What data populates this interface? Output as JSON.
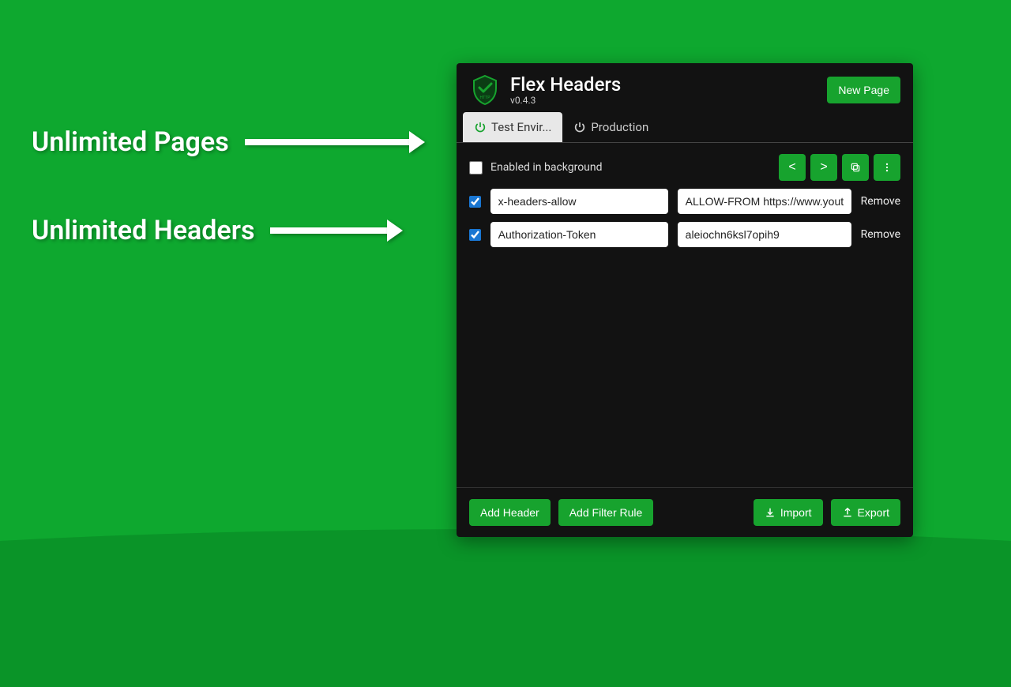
{
  "callouts": {
    "pages": "Unlimited Pages",
    "headers": "Unlimited Headers"
  },
  "app": {
    "title": "Flex Headers",
    "version": "v0.4.3",
    "new_page": "New Page"
  },
  "tabs": [
    {
      "label": "Test Envir...",
      "active": true
    },
    {
      "label": "Production",
      "active": false
    }
  ],
  "toolbar": {
    "enabled_label": "Enabled in background",
    "enabled_checked": false,
    "prev": "<",
    "next": ">"
  },
  "headers": [
    {
      "checked": true,
      "key": "x-headers-allow",
      "value": "ALLOW-FROM https://www.youtub",
      "remove": "Remove"
    },
    {
      "checked": true,
      "key": "Authorization-Token",
      "value": "aleiochn6ksl7opih9",
      "remove": "Remove"
    }
  ],
  "footer": {
    "add_header": "Add Header",
    "add_filter": "Add Filter Rule",
    "import": "Import",
    "export": "Export"
  }
}
